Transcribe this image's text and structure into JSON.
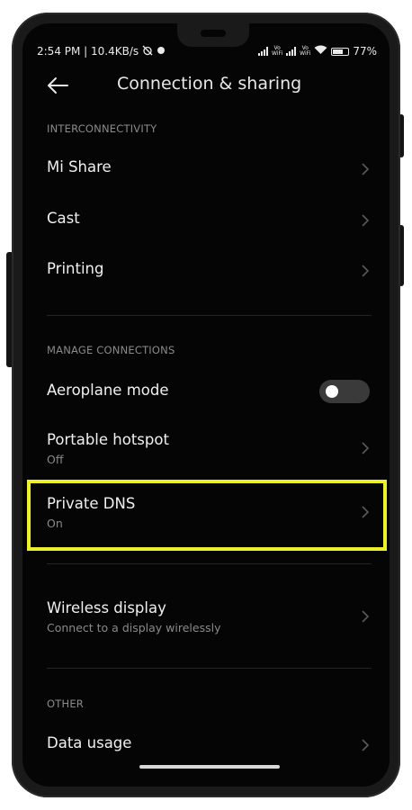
{
  "status_bar": {
    "time_speed": "2:54 PM | 10.4KB/s",
    "vo_wifi_1": [
      "Vo",
      "WiFi"
    ],
    "vo_wifi_2": [
      "Vo",
      "WiFi"
    ],
    "battery_percent": "77%",
    "battery_level": 0.77
  },
  "header": {
    "title": "Connection & sharing"
  },
  "sections": {
    "interconnectivity": "INTERCONNECTIVITY",
    "manage_connections": "MANAGE CONNECTIONS",
    "other": "OTHER"
  },
  "items": {
    "mi_share": "Mi Share",
    "cast": "Cast",
    "printing": "Printing",
    "aeroplane_mode": "Aeroplane mode",
    "aeroplane_mode_on": false,
    "portable_hotspot": "Portable hotspot",
    "portable_hotspot_sub": "Off",
    "private_dns": "Private DNS",
    "private_dns_sub": "On",
    "wireless_display": "Wireless display",
    "wireless_display_sub": "Connect to a display wirelessly",
    "data_usage": "Data usage"
  },
  "colors": {
    "background": "#050505",
    "highlight": "#eef02a",
    "text_primary": "#f0f0f0",
    "text_secondary": "#8a8a8a"
  }
}
